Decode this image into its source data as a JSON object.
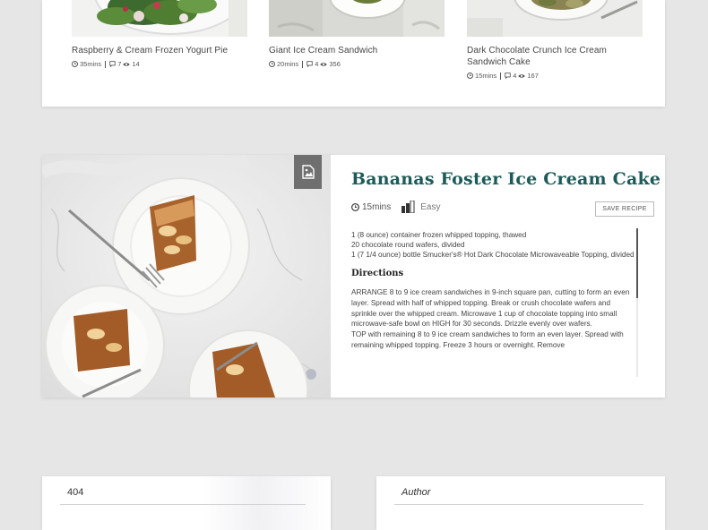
{
  "recipes": [
    {
      "title": "Raspberry & Cream Frozen Yogurt Pie",
      "time": "35mins",
      "comments": "7",
      "views": "14"
    },
    {
      "title": "Giant Ice Cream Sandwich",
      "time": "20mins",
      "comments": "4",
      "views": "356"
    },
    {
      "title": "Dark Chocolate Crunch Ice Cream Sandwich Cake",
      "time": "15mins",
      "comments": "4",
      "views": "167"
    }
  ],
  "featured": {
    "title": "Bananas Foster Ice Cream Cake",
    "time": "15mins",
    "difficulty": "Easy",
    "save_label": "SAVE RECIPE",
    "ingredients": [
      "1 (8 ounce) container frozen whipped topping, thawed",
      "20 chocolate round wafers, divided",
      "1 (7 1/4 ounce) bottle Smucker's® Hot Dark Chocolate Microwaveable Topping, divided"
    ],
    "directions_heading": "Directions",
    "directions": [
      "ARRANGE 8 to 9 ice cream sandwiches in 9-inch square pan, cutting to form an even layer. Spread with half of whipped topping. Break or crush chocolate wafers and sprinkle over the whipped cream. Microwave 1 cup of chocolate topping into small microwave-safe bowl on HIGH for 30 seconds. Drizzle evenly over wafers.",
      "TOP with remaining 8 to 9 ice cream sandwiches to form an even layer. Spread with remaining whipped topping. Freeze 3 hours or overnight. Remove"
    ]
  },
  "bottom": {
    "left_title": "404",
    "right_title": "Author"
  },
  "colors": {
    "accent": "#1d5b59",
    "background": "#e6e6e6"
  }
}
